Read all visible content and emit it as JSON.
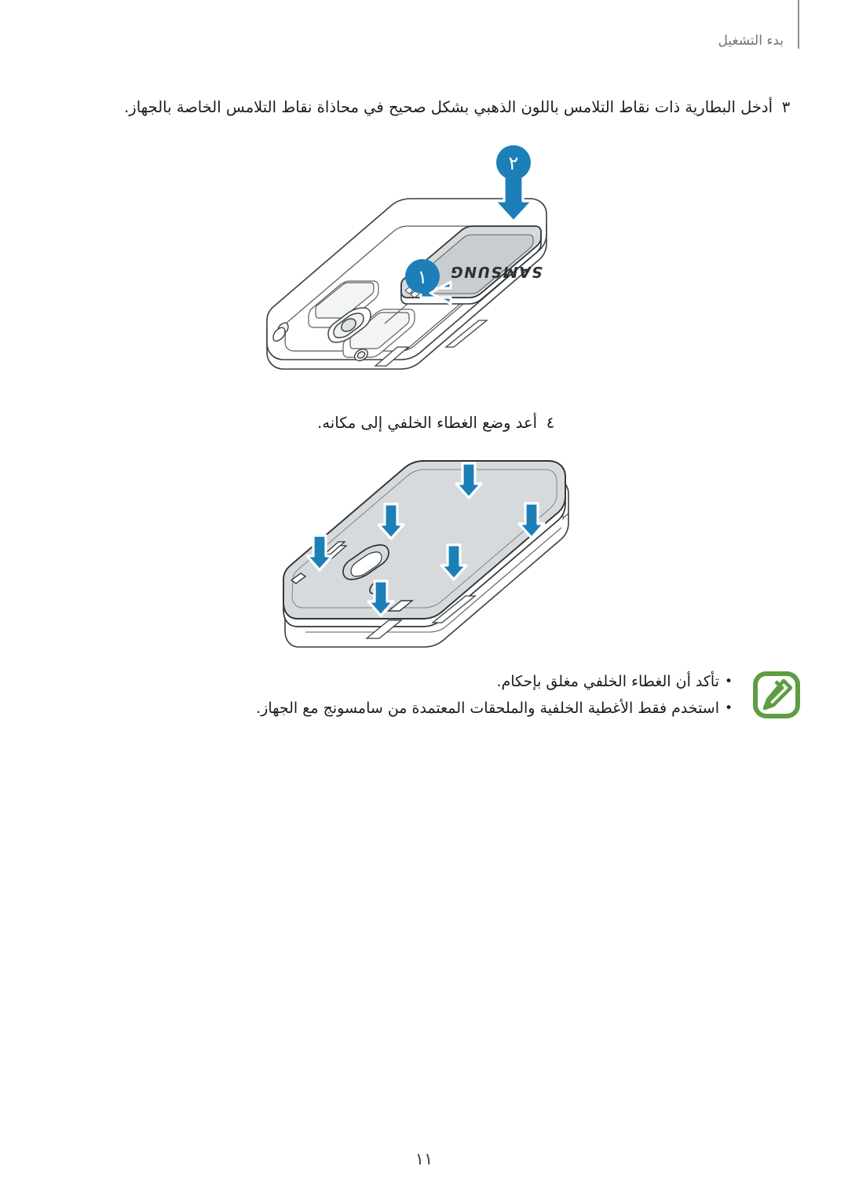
{
  "header": {
    "title": "بدء التشغيل"
  },
  "steps": [
    {
      "number": "٣",
      "text": "أدخل البطارية ذات نقاط التلامس باللون الذهبي بشكل صحيح في محاذاة نقاط التلامس الخاصة بالجهاز."
    },
    {
      "number": "٤",
      "text": "أعد وضع الغطاء الخلفي إلى مكانه."
    }
  ],
  "illustration_battery": {
    "name": "battery-insertion-diagram",
    "badge_one": "١",
    "badge_two": "٢",
    "battery_label": "SAMSUNG",
    "accent_blue": "#1d7fb8",
    "battery_fill": "#d7dadc",
    "phone_outline": "#3a3f42"
  },
  "illustration_cover": {
    "name": "back-cover-press-diagram",
    "accent_blue": "#1d7fb8",
    "cover_fill": "#d7dadc",
    "arrow_count": 6,
    "phone_outline": "#3a3f42"
  },
  "note": {
    "icon": "note-pen-icon",
    "icon_color": "#5c9e41",
    "bullet": "•",
    "items": [
      "تأكد أن الغطاء الخلفي مغلق بإحكام.",
      "استخدم فقط الأغطية الخلفية والملحقات المعتمدة من سامسونج مع الجهاز."
    ]
  },
  "footer": {
    "page_number": "١١"
  }
}
